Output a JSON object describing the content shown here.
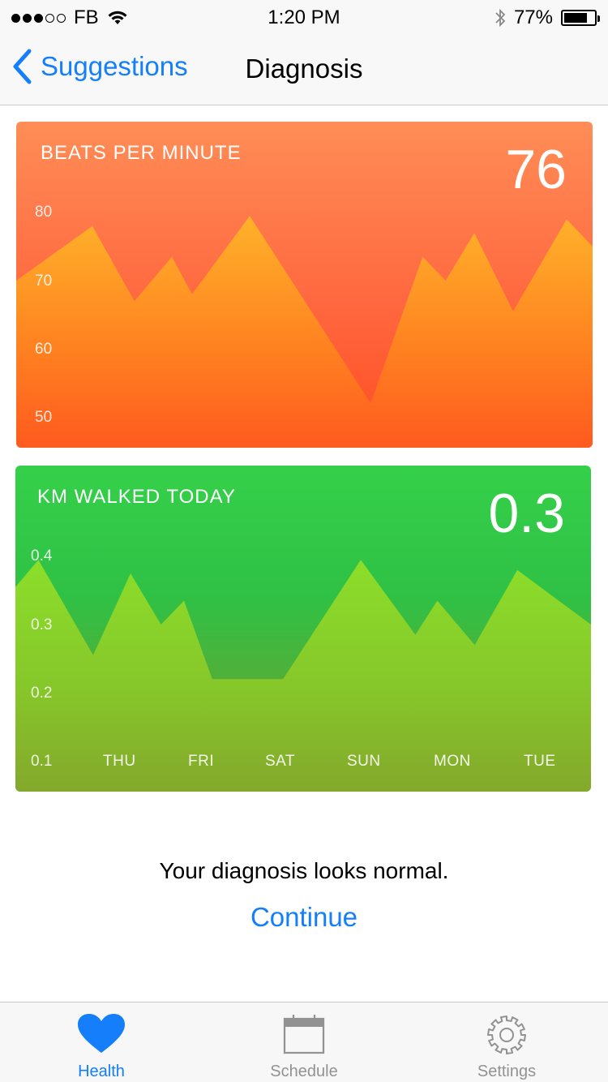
{
  "status_bar": {
    "carrier": "FB",
    "time": "1:20 PM",
    "battery_percent": "77%",
    "battery_level": 0.77,
    "signal_bars": 3,
    "signal_total": 5
  },
  "nav": {
    "back_label": "Suggestions",
    "title": "Diagnosis"
  },
  "heart_card": {
    "title": "BEATS PER MINUTE",
    "value": "76",
    "y_ticks": [
      "80",
      "70",
      "60",
      "50"
    ]
  },
  "walk_card": {
    "title": "KM WALKED TODAY",
    "value": "0.3",
    "y_ticks": [
      "0.4",
      "0.3",
      "0.2",
      "0.1"
    ],
    "x_ticks": [
      "THU",
      "FRI",
      "SAT",
      "SUN",
      "MON",
      "TUE"
    ]
  },
  "chart_data": [
    {
      "type": "area",
      "title": "BEATS PER MINUTE",
      "ylim": [
        45,
        85
      ],
      "y_ticks": [
        80,
        70,
        60,
        50
      ],
      "x": [
        0,
        0.132,
        0.205,
        0.27,
        0.305,
        0.405,
        0.615,
        0.705,
        0.745,
        0.795,
        0.862,
        0.955,
        1.0
      ],
      "values": [
        70,
        78,
        67,
        73.5,
        68,
        79.5,
        52,
        73.5,
        70,
        77,
        65.5,
        79,
        75
      ]
    },
    {
      "type": "area",
      "title": "KM WALKED TODAY",
      "ylim": [
        0.1,
        0.45
      ],
      "y_ticks": [
        0.4,
        0.3,
        0.2,
        0.1
      ],
      "categories": [
        "THU",
        "FRI",
        "SAT",
        "SUN",
        "MON",
        "TUE"
      ],
      "x": [
        0,
        0.04,
        0.135,
        0.2,
        0.253,
        0.293,
        0.342,
        0.465,
        0.6,
        0.695,
        0.733,
        0.798,
        0.872,
        1.0
      ],
      "values": [
        0.355,
        0.395,
        0.255,
        0.375,
        0.3,
        0.335,
        0.22,
        0.22,
        0.395,
        0.285,
        0.335,
        0.27,
        0.38,
        0.3
      ]
    }
  ],
  "message": {
    "diagnosis": "Your diagnosis looks normal.",
    "continue_label": "Continue"
  },
  "tabs": [
    {
      "label": "Health",
      "icon": "heart-icon",
      "active": true
    },
    {
      "label": "Schedule",
      "icon": "calendar-icon",
      "active": false
    },
    {
      "label": "Settings",
      "icon": "gear-icon",
      "active": false
    }
  ],
  "colors": {
    "accent": "#147efb",
    "heart_area_top": "#ffb22a",
    "heart_area_bottom": "#ff5a1f",
    "walk_area_top": "#8cde2a",
    "walk_area_bottom": "#84a82c",
    "tab_inactive": "#929292"
  }
}
